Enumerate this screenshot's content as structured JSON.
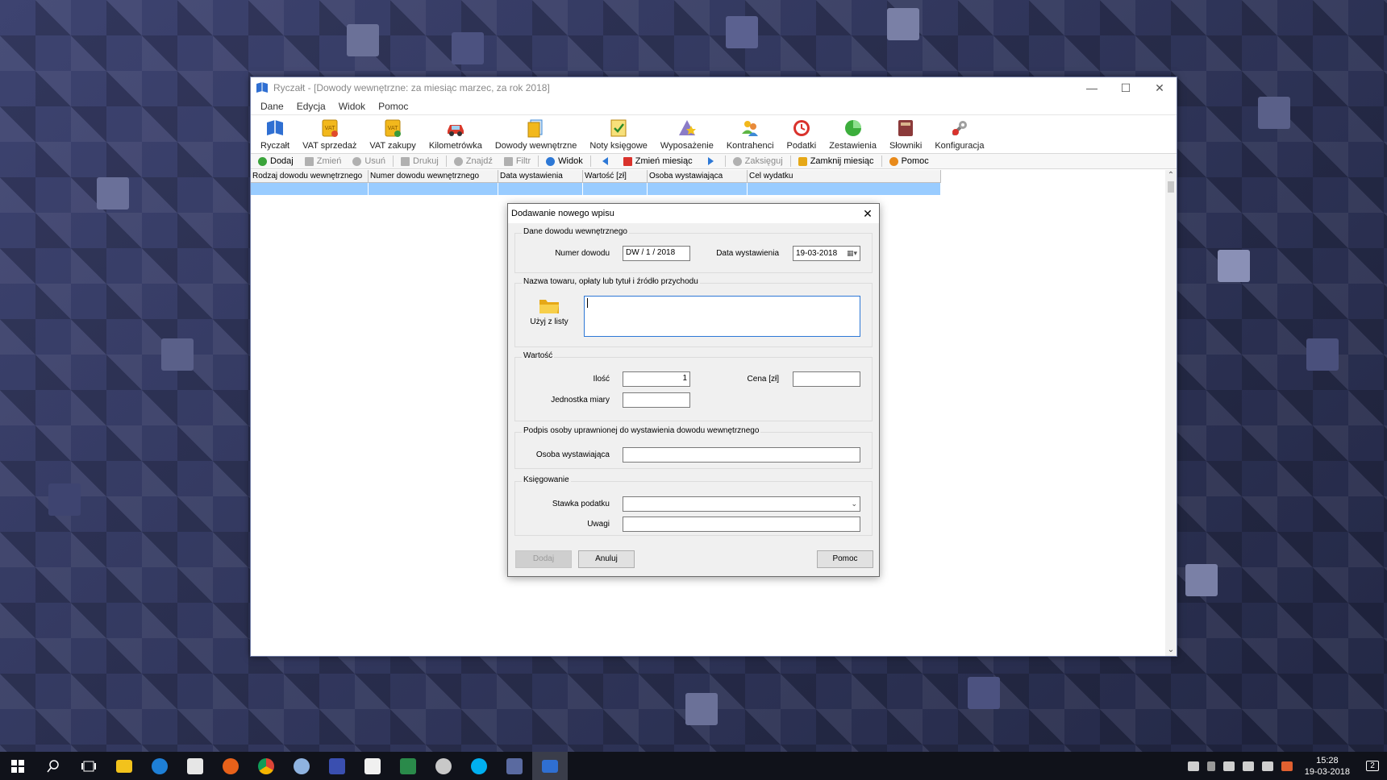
{
  "window": {
    "title": "Ryczałt - [Dowody wewnętrzne: za miesiąc marzec, za rok 2018]",
    "controls": [
      "—",
      "☐",
      "✕"
    ]
  },
  "menu": [
    "Dane",
    "Edycja",
    "Widok",
    "Pomoc"
  ],
  "toolbar": [
    {
      "label": "Ryczałt",
      "icon": "book-icon",
      "color": "#2f6fd2"
    },
    {
      "label": "VAT sprzedaż",
      "icon": "vat-sale-icon",
      "color": "#f2b81c"
    },
    {
      "label": "VAT zakupy",
      "icon": "vat-purchase-icon",
      "color": "#f2b81c"
    },
    {
      "label": "Kilometrówka",
      "icon": "car-icon",
      "color": "#d93a2c"
    },
    {
      "label": "Dowody wewnętrzne",
      "icon": "documents-icon",
      "color": "#3d8ad6"
    },
    {
      "label": "Noty księgowe",
      "icon": "note-icon",
      "color": "#f2b81c"
    },
    {
      "label": "Wyposażenie",
      "icon": "equipment-icon",
      "color": "#8b7cc7"
    },
    {
      "label": "Kontrahenci",
      "icon": "contacts-icon",
      "color": "#5db544"
    },
    {
      "label": "Podatki",
      "icon": "tax-clock-icon",
      "color": "#d9322c"
    },
    {
      "label": "Zestawienia",
      "icon": "pie-chart-icon",
      "color": "#3cae3c"
    },
    {
      "label": "Słowniki",
      "icon": "dictionary-icon",
      "color": "#8b3a3a"
    },
    {
      "label": "Konfiguracja",
      "icon": "wrench-icon",
      "color": "#8a8a8a"
    }
  ],
  "actions": {
    "add": "Dodaj",
    "edit": "Zmień",
    "delete": "Usuń",
    "print": "Drukuj",
    "find": "Znajdź",
    "filter": "Filtr",
    "view": "Widok",
    "change_month": "Zmień miesiąc",
    "book": "Zaksięguj",
    "close_month": "Zamknij miesiąc",
    "help": "Pomoc"
  },
  "grid": {
    "columns": [
      "Rodzaj dowodu wewnętrznego",
      "Numer dowodu wewnętrznego",
      "Data wystawienia",
      "Wartość [zł]",
      "Osoba wystawiająca",
      "Cel wydatku"
    ]
  },
  "dialog": {
    "title": "Dodawanie nowego wpisu",
    "group_doc": "Dane dowodu wewnętrznego",
    "doc_number_label": "Numer dowodu",
    "doc_number": "DW / 1 / 2018",
    "issue_date_label": "Data wystawienia",
    "issue_date": "19-03-2018",
    "group_name": "Nazwa towaru, opłaty lub tytuł i źródło przychodu",
    "use_list": "Użyj z listy",
    "name_value": "",
    "group_value": "Wartość",
    "qty_label": "Ilość",
    "qty": "1",
    "price_label": "Cena [zł]",
    "price": "",
    "unit_label": "Jednostka miary",
    "unit": "",
    "group_sign": "Podpis osoby uprawnionej do wystawienia dowodu wewnętrznego",
    "issuer_label": "Osoba wystawiająca",
    "issuer": "",
    "group_booking": "Księgowanie",
    "tax_rate_label": "Stawka podatku",
    "tax_rate": "",
    "notes_label": "Uwagi",
    "notes": "",
    "btn_add": "Dodaj",
    "btn_cancel": "Anuluj",
    "btn_help": "Pomoc"
  },
  "taskbar": {
    "time": "15:28",
    "date": "19-03-2018",
    "notifications": "2"
  }
}
